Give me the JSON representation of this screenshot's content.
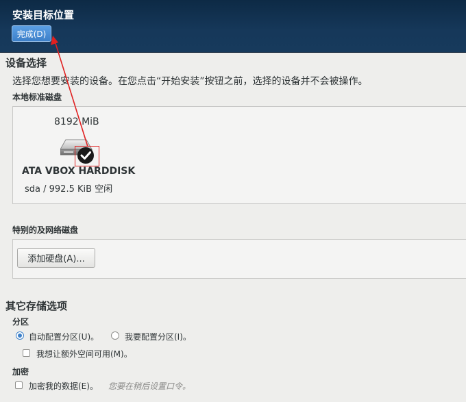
{
  "header": {
    "title": "安装目标位置",
    "done_button": "完成(D)"
  },
  "device_selection": {
    "title": "设备选择",
    "description": "选择您想要安装的设备。在您点击“开始安装”按钮之前，选择的设备并不会被操作。",
    "local_disks": {
      "title": "本地标准磁盘",
      "disks": [
        {
          "size": "8192 MiB",
          "name": "ATA VBOX HARDDISK",
          "info": "sda  /  992.5 KiB 空闲",
          "selected": true
        }
      ]
    },
    "network_disks": {
      "title": "特别的及网络磁盘",
      "add_button": "添加硬盘(A)..."
    }
  },
  "other_storage": {
    "title": "其它存储选项",
    "partition": {
      "title": "分区",
      "auto_option": "自动配置分区(U)。",
      "manual_option": "我要配置分区(I)。",
      "selected": "auto",
      "extra_space_option": "我想让额外空间可用(M)。"
    },
    "encryption": {
      "title": "加密",
      "encrypt_option": "加密我的数据(E)。",
      "hint": "您要在稍后设置口令。"
    }
  },
  "colors": {
    "header_bg": "#16385a",
    "accent": "#3d80c9",
    "annotation": "#e02020"
  },
  "icons": {
    "disk": "harddisk-icon",
    "selected": "checkmark-icon"
  }
}
